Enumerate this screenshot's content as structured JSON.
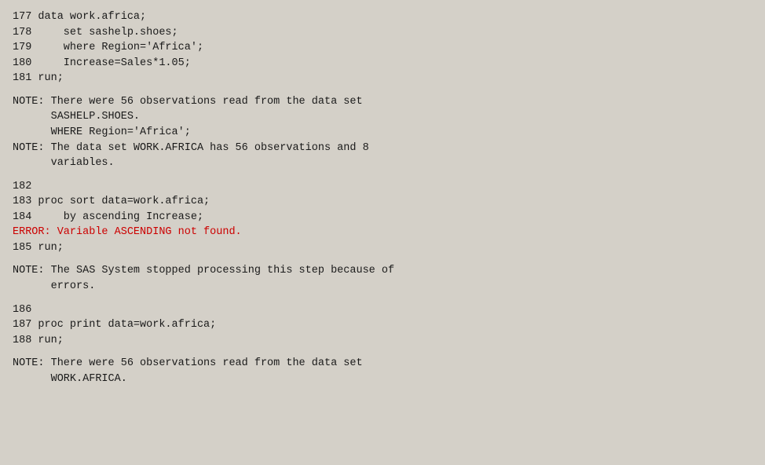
{
  "log": {
    "lines": [
      {
        "type": "code",
        "text": "177 data work.africa;"
      },
      {
        "type": "code",
        "text": "178     set sashelp.shoes;"
      },
      {
        "type": "code",
        "text": "179     where Region='Africa';"
      },
      {
        "type": "code",
        "text": "180     Increase=Sales*1.05;"
      },
      {
        "type": "code",
        "text": "181 run;"
      },
      {
        "type": "spacer"
      },
      {
        "type": "note",
        "text": "NOTE: There were 56 observations read from the data set"
      },
      {
        "type": "note",
        "text": "      SASHELP.SHOES."
      },
      {
        "type": "note",
        "text": "      WHERE Region='Africa';"
      },
      {
        "type": "note",
        "text": "NOTE: The data set WORK.AFRICA has 56 observations and 8"
      },
      {
        "type": "note",
        "text": "      variables."
      },
      {
        "type": "spacer"
      },
      {
        "type": "code",
        "text": "182"
      },
      {
        "type": "code",
        "text": "183 proc sort data=work.africa;"
      },
      {
        "type": "code",
        "text": "184     by ascending Increase;"
      },
      {
        "type": "error",
        "text": "ERROR: Variable ASCENDING not found."
      },
      {
        "type": "code",
        "text": "185 run;"
      },
      {
        "type": "spacer"
      },
      {
        "type": "note",
        "text": "NOTE: The SAS System stopped processing this step because of"
      },
      {
        "type": "note",
        "text": "      errors."
      },
      {
        "type": "spacer"
      },
      {
        "type": "code",
        "text": "186"
      },
      {
        "type": "code",
        "text": "187 proc print data=work.africa;"
      },
      {
        "type": "code",
        "text": "188 run;"
      },
      {
        "type": "spacer"
      },
      {
        "type": "note",
        "text": "NOTE: There were 56 observations read from the data set"
      },
      {
        "type": "note",
        "text": "      WORK.AFRICA."
      }
    ]
  }
}
